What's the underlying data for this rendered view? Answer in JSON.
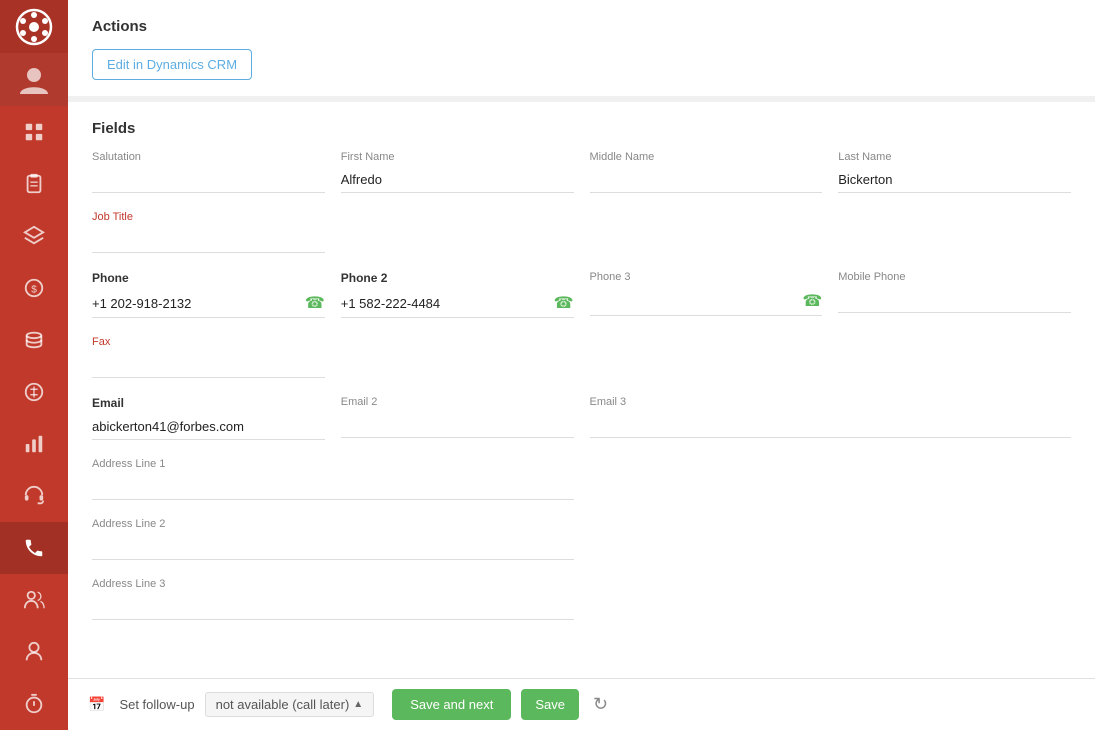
{
  "sidebar": {
    "logo_icon": "film-reel-icon",
    "avatar_icon": "user-avatar-icon",
    "items": [
      {
        "id": "dashboard",
        "icon": "grid-icon",
        "active": false
      },
      {
        "id": "clipboard",
        "icon": "clipboard-icon",
        "active": false
      },
      {
        "id": "layers",
        "icon": "layers-icon",
        "active": false
      },
      {
        "id": "coin1",
        "icon": "coin-icon",
        "active": false
      },
      {
        "id": "coin2",
        "icon": "coin-stack-icon",
        "active": false
      },
      {
        "id": "coin3",
        "icon": "coin-alt-icon",
        "active": false
      },
      {
        "id": "bar-chart",
        "icon": "bar-chart-icon",
        "active": false
      },
      {
        "id": "headset",
        "icon": "headset-icon",
        "active": false
      },
      {
        "id": "phone",
        "icon": "phone-icon",
        "active": true
      },
      {
        "id": "users-alt",
        "icon": "users-alt-icon",
        "active": false
      },
      {
        "id": "user-single",
        "icon": "user-single-icon",
        "active": false
      },
      {
        "id": "timer",
        "icon": "timer-icon",
        "active": false
      }
    ]
  },
  "actions": {
    "title": "Actions",
    "edit_crm_button": "Edit in Dynamics CRM"
  },
  "fields": {
    "title": "Fields",
    "salutation": {
      "label": "Salutation",
      "value": ""
    },
    "first_name": {
      "label": "First Name",
      "value": "Alfredo"
    },
    "middle_name": {
      "label": "Middle Name",
      "value": ""
    },
    "last_name": {
      "label": "Last Name",
      "value": "Bickerton"
    },
    "job_title": {
      "label": "Job Title",
      "value": ""
    },
    "phone": {
      "label": "Phone",
      "value": "+1 202-918-2132"
    },
    "phone2": {
      "label": "Phone 2",
      "value": "+1 582-222-4484"
    },
    "phone3": {
      "label": "Phone 3",
      "value": ""
    },
    "mobile_phone": {
      "label": "Mobile Phone",
      "value": ""
    },
    "fax": {
      "label": "Fax",
      "value": ""
    },
    "email": {
      "label": "Email",
      "value": "abickerton41@forbes.com"
    },
    "email2": {
      "label": "Email 2",
      "value": ""
    },
    "email3": {
      "label": "Email 3",
      "value": ""
    },
    "address_line1": {
      "label": "Address Line 1",
      "value": ""
    },
    "address_line2": {
      "label": "Address Line 2",
      "value": ""
    },
    "address_line3": {
      "label": "Address Line 3",
      "value": ""
    }
  },
  "footer": {
    "follow_up_label": "Set follow-up",
    "follow_up_status": "not available (call later)",
    "save_next_label": "Save and next",
    "save_label": "Save",
    "undo_icon": "undo-icon"
  }
}
